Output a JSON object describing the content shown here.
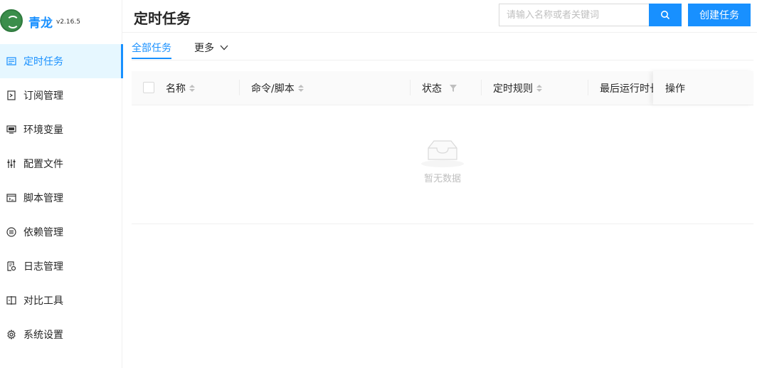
{
  "app": {
    "name": "青龙",
    "version": "v2.16.5"
  },
  "sidebar": {
    "items": [
      {
        "label": "定时任务",
        "icon": "calendar-list-icon",
        "active": true
      },
      {
        "label": "订阅管理",
        "icon": "subscription-icon"
      },
      {
        "label": "环境变量",
        "icon": "monitor-icon"
      },
      {
        "label": "配置文件",
        "icon": "sliders-icon"
      },
      {
        "label": "脚本管理",
        "icon": "code-file-icon"
      },
      {
        "label": "依赖管理",
        "icon": "list-circle-icon"
      },
      {
        "label": "日志管理",
        "icon": "log-file-icon"
      },
      {
        "label": "对比工具",
        "icon": "diff-icon"
      },
      {
        "label": "系统设置",
        "icon": "gear-icon"
      }
    ]
  },
  "header": {
    "title": "定时任务",
    "search_placeholder": "请输入名称或者关键词",
    "create_label": "创建任务"
  },
  "tabs": {
    "all": "全部任务",
    "more": "更多"
  },
  "table": {
    "columns": {
      "name": "名称",
      "command": "命令/脚本",
      "status": "状态",
      "schedule": "定时规则",
      "last_run": "最后运行时长",
      "actions": "操作"
    },
    "empty_text": "暂无数据",
    "rows": []
  },
  "colors": {
    "accent": "#1890ff",
    "active_bg": "#e6f7ff"
  }
}
